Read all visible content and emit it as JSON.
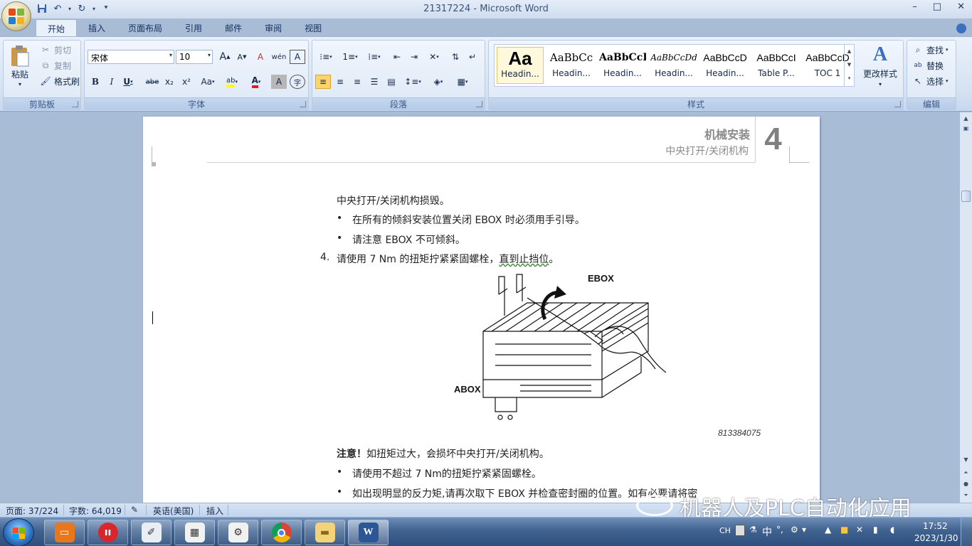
{
  "window": {
    "title": "21317224 - Microsoft Word",
    "minimize": "–",
    "maximize": "□",
    "close": "✕"
  },
  "quick_access": [
    "save-icon",
    "undo-icon",
    "redo-icon",
    "customize-icon"
  ],
  "ribbon_tabs": [
    "开始",
    "插入",
    "页面布局",
    "引用",
    "邮件",
    "审阅",
    "视图"
  ],
  "clipboard": {
    "paste": "粘贴",
    "cut": "剪切",
    "copy": "复制",
    "format_painter": "格式刷",
    "label": "剪贴板"
  },
  "font": {
    "name": "宋体",
    "size": "10",
    "grow": "A",
    "shrink": "A",
    "clear": "A",
    "phonetic": "wén",
    "border_char": "A",
    "bold": "B",
    "italic": "I",
    "underline": "U",
    "strike": "abe",
    "sub": "x₂",
    "sup": "x²",
    "case": "Aa",
    "highlight": "ab",
    "color": "A",
    "shade": "A",
    "enclose": "字",
    "label": "字体",
    "font_color_hex": "#e02020",
    "highlight_hex": "#ffff00"
  },
  "paragraph": {
    "label": "段落"
  },
  "styles": {
    "label": "样式",
    "items": [
      {
        "preview": "Aa",
        "name": "Headin..."
      },
      {
        "preview": "AaBbCc",
        "name": "Headin..."
      },
      {
        "preview": "AaBbCcI",
        "name": "Headin..."
      },
      {
        "preview": "AaBbCcDd",
        "name": "Headin..."
      },
      {
        "preview": "AaBbCcD",
        "name": "Headin..."
      },
      {
        "preview": "AaBbCcI",
        "name": "Table P..."
      },
      {
        "preview": "AaBbCcD",
        "name": "TOC 1"
      }
    ],
    "change_styles": "更改样式"
  },
  "editing": {
    "find": "查找",
    "replace": "替换",
    "select": "选择",
    "label": "编辑"
  },
  "document": {
    "header_title": "机械安装",
    "header_subtitle": "中央打开/关闭机构",
    "chapter_number": "4",
    "lines": {
      "p1": "中央打开/关闭机构损毁。",
      "b1": "在所有的倾斜安装位置关闭 EBOX 时必须用手引导。",
      "b2": "请注意 EBOX 不可倾斜。",
      "step_num": "4.",
      "step_text_a": "请使用 7 Nm 的扭矩拧紧紧固螺栓，",
      "step_text_b": "直到止挡位",
      "step_text_c": "。",
      "note_bold": "注意！",
      "note_text": "如扭矩过大，会损坏中央打开/关闭机构。",
      "b3": "请使用不超过 7 Nm的扭矩拧紧紧固螺栓。",
      "b4": "如出现明显的反力矩,请再次取下 EBOX 并检查密封圈的位置。如有必要请将密"
    },
    "bullet": "•",
    "figure": {
      "label_ebox": "EBOX",
      "label_abox": "ABOX",
      "figure_number": "813384075"
    }
  },
  "status": {
    "page": "页面: 37/224",
    "words": "字数: 64,019",
    "language": "英语(美国)",
    "mode": "插入"
  },
  "watermark": "机器人及PLC自动化应用",
  "taskbar": {
    "apps": [
      "changer-app",
      "huawei-app",
      "pen-tool-app",
      "diagram-app",
      "figure-app",
      "chrome-app",
      "explorer-app",
      "word-app"
    ],
    "tray": {
      "lang": "CH",
      "ime": "中",
      "time": "17:52",
      "date": "2023/1/30"
    }
  }
}
